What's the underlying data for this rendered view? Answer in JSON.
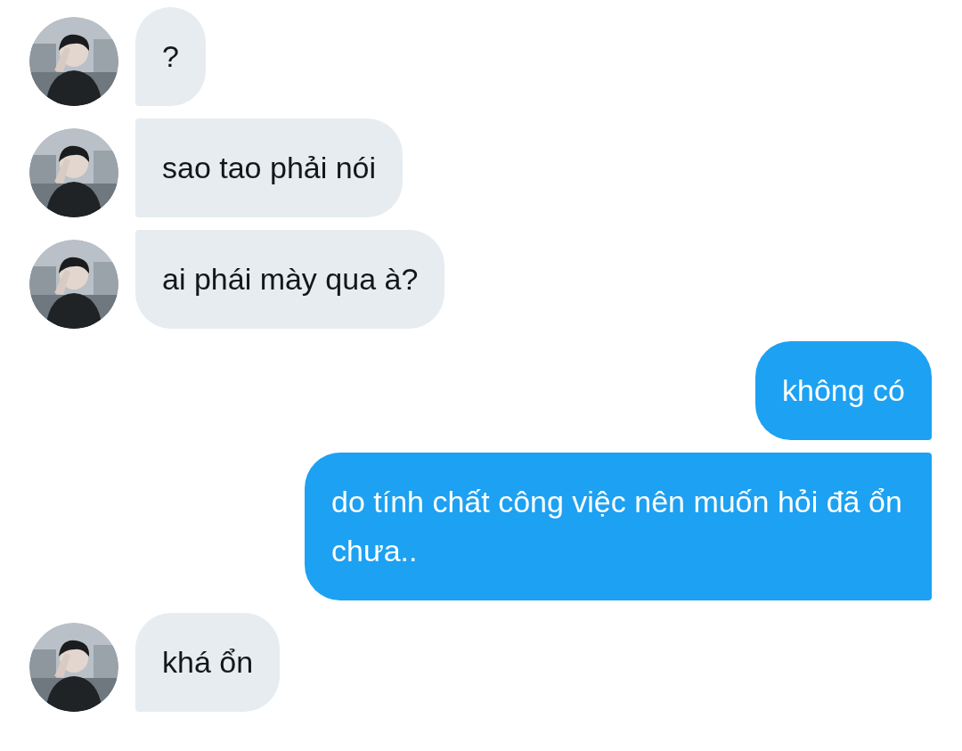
{
  "messages": [
    {
      "kind": "incoming",
      "text": "?"
    },
    {
      "kind": "incoming",
      "text": "sao tao phải nói"
    },
    {
      "kind": "incoming",
      "text": "ai phái mày qua à?"
    },
    {
      "kind": "outgoing",
      "text": "không có"
    },
    {
      "kind": "outgoing",
      "text": "do tính chất công việc nên muốn hỏi đã ổn chưa.."
    },
    {
      "kind": "incoming",
      "text": "khá ổn"
    }
  ]
}
